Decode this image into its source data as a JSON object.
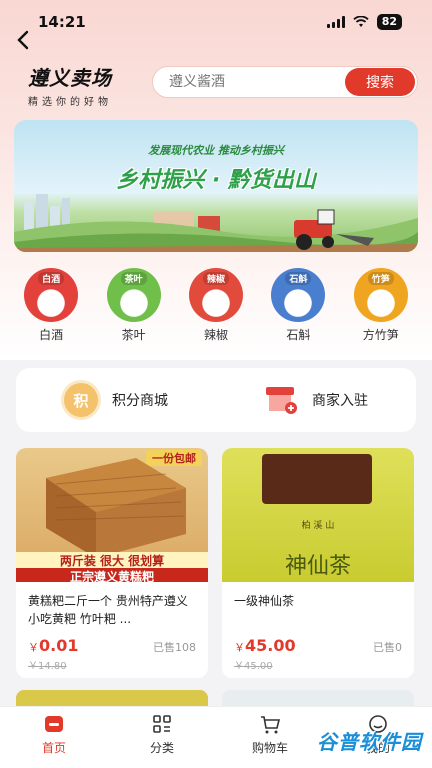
{
  "status": {
    "time": "14:21",
    "battery": "82"
  },
  "header": {
    "logo_title": "遵义卖场",
    "logo_subtitle": "精选你的好物"
  },
  "search": {
    "placeholder": "遵义酱酒",
    "button_label": "搜索"
  },
  "banner": {
    "subtitle": "发展现代农业  推动乡村振兴",
    "title": "乡村振兴 · 黔货出山"
  },
  "categories": [
    {
      "label": "白酒",
      "tag": "白酒",
      "color": "#e2423b"
    },
    {
      "label": "茶叶",
      "tag": "茶叶",
      "color": "#6fbf4a"
    },
    {
      "label": "辣椒",
      "tag": "辣椒",
      "color": "#e24a3b"
    },
    {
      "label": "石斛",
      "tag": "石斛",
      "color": "#4a7fd0"
    },
    {
      "label": "方竹笋",
      "tag": "竹笋",
      "color": "#f0a520"
    }
  ],
  "quick_links": {
    "points_icon_text": "积",
    "points_label": "积分商城",
    "merchant_label": "商家入驻"
  },
  "products": [
    {
      "title": "黄糕粑二斤一个 贵州特产遵义小吃黄粑 竹叶粑 ...",
      "price_symbol": "￥",
      "price": "0.01",
      "sold": "已售108",
      "original": "￥14.80",
      "img_banner_top": "一份包邮",
      "img_banner_mid": "两斤装 很大 很划算",
      "img_banner_bottom": "正宗遵义黄糕粑"
    },
    {
      "title": "一级神仙茶",
      "price_symbol": "￥",
      "price": "45.00",
      "sold": "已售0",
      "original": "￥45.00",
      "img_brand": "柏 溪 山",
      "img_name": "神仙茶"
    }
  ],
  "tabbar": {
    "home": "首页",
    "category": "分类",
    "cart": "购物车",
    "mine": "我的"
  },
  "watermark": "谷普软件园",
  "colors": {
    "accent": "#e13a2b",
    "background": "#f3f3f5"
  }
}
